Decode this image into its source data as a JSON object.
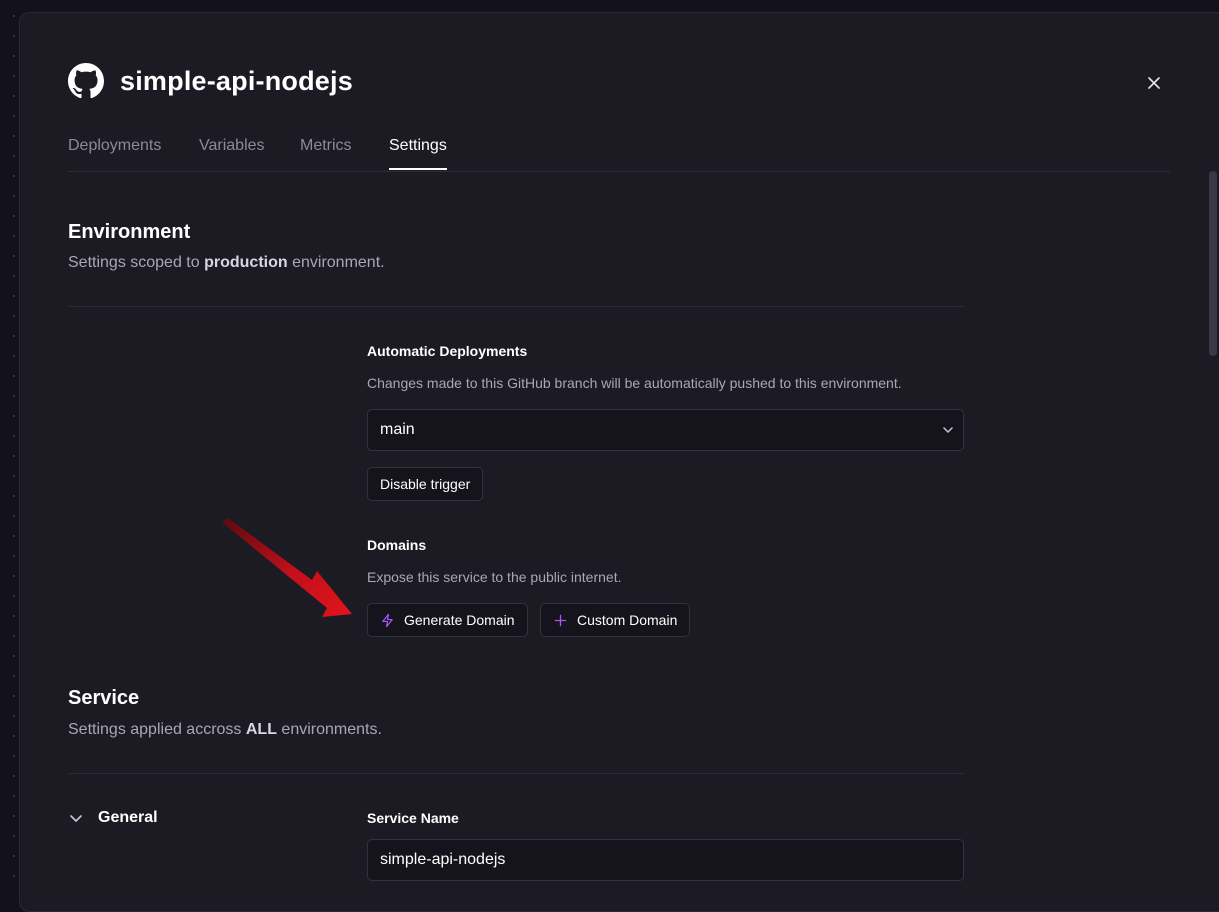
{
  "header": {
    "title": "simple-api-nodejs",
    "icon": "github-icon",
    "close_icon": "close-icon"
  },
  "tabs": [
    {
      "label": "Deployments",
      "active": false
    },
    {
      "label": "Variables",
      "active": false
    },
    {
      "label": "Metrics",
      "active": false
    },
    {
      "label": "Settings",
      "active": true
    }
  ],
  "environment": {
    "title": "Environment",
    "sub_prefix": "Settings scoped to ",
    "sub_bold": "production",
    "sub_suffix": " environment."
  },
  "auto_deploy": {
    "label": "Automatic Deployments",
    "help": "Changes made to this GitHub branch will be automatically pushed to this environment.",
    "branch_value": "main",
    "disable_label": "Disable trigger"
  },
  "domains": {
    "label": "Domains",
    "help": "Expose this service to the public internet.",
    "generate_label": "Generate Domain",
    "custom_label": "Custom Domain",
    "accent_color": "#a855f7"
  },
  "service": {
    "title": "Service",
    "sub_prefix": "Settings applied accross ",
    "sub_bold": "ALL",
    "sub_suffix": " environments.",
    "general_label": "General",
    "name_label": "Service Name",
    "name_value": "simple-api-nodejs"
  },
  "annotation": {
    "arrow_color": "#d1141b"
  }
}
